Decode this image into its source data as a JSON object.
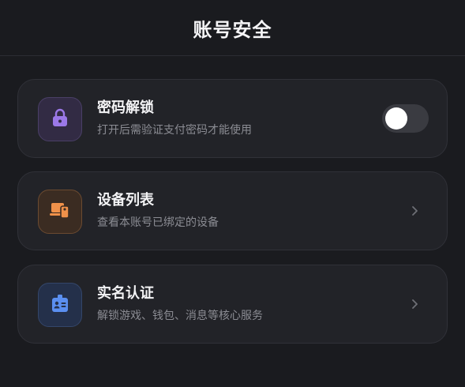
{
  "header": {
    "title": "账号安全"
  },
  "items": [
    {
      "title": "密码解锁",
      "description": "打开后需验证支付密码才能使用",
      "icon": "lock-icon",
      "icon_color": "#9b78e8",
      "control": "toggle",
      "toggle_on": false
    },
    {
      "title": "设备列表",
      "description": "查看本账号已绑定的设备",
      "icon": "device-icon",
      "icon_color": "#f0914a",
      "control": "chevron"
    },
    {
      "title": "实名认证",
      "description": "解锁游戏、钱包、消息等核心服务",
      "icon": "id-badge-icon",
      "icon_color": "#5b8ff0",
      "control": "chevron"
    }
  ],
  "colors": {
    "background": "#1a1b1f",
    "card": "#222328",
    "title_text": "#f3f3f5",
    "description_text": "#8b8c93"
  }
}
